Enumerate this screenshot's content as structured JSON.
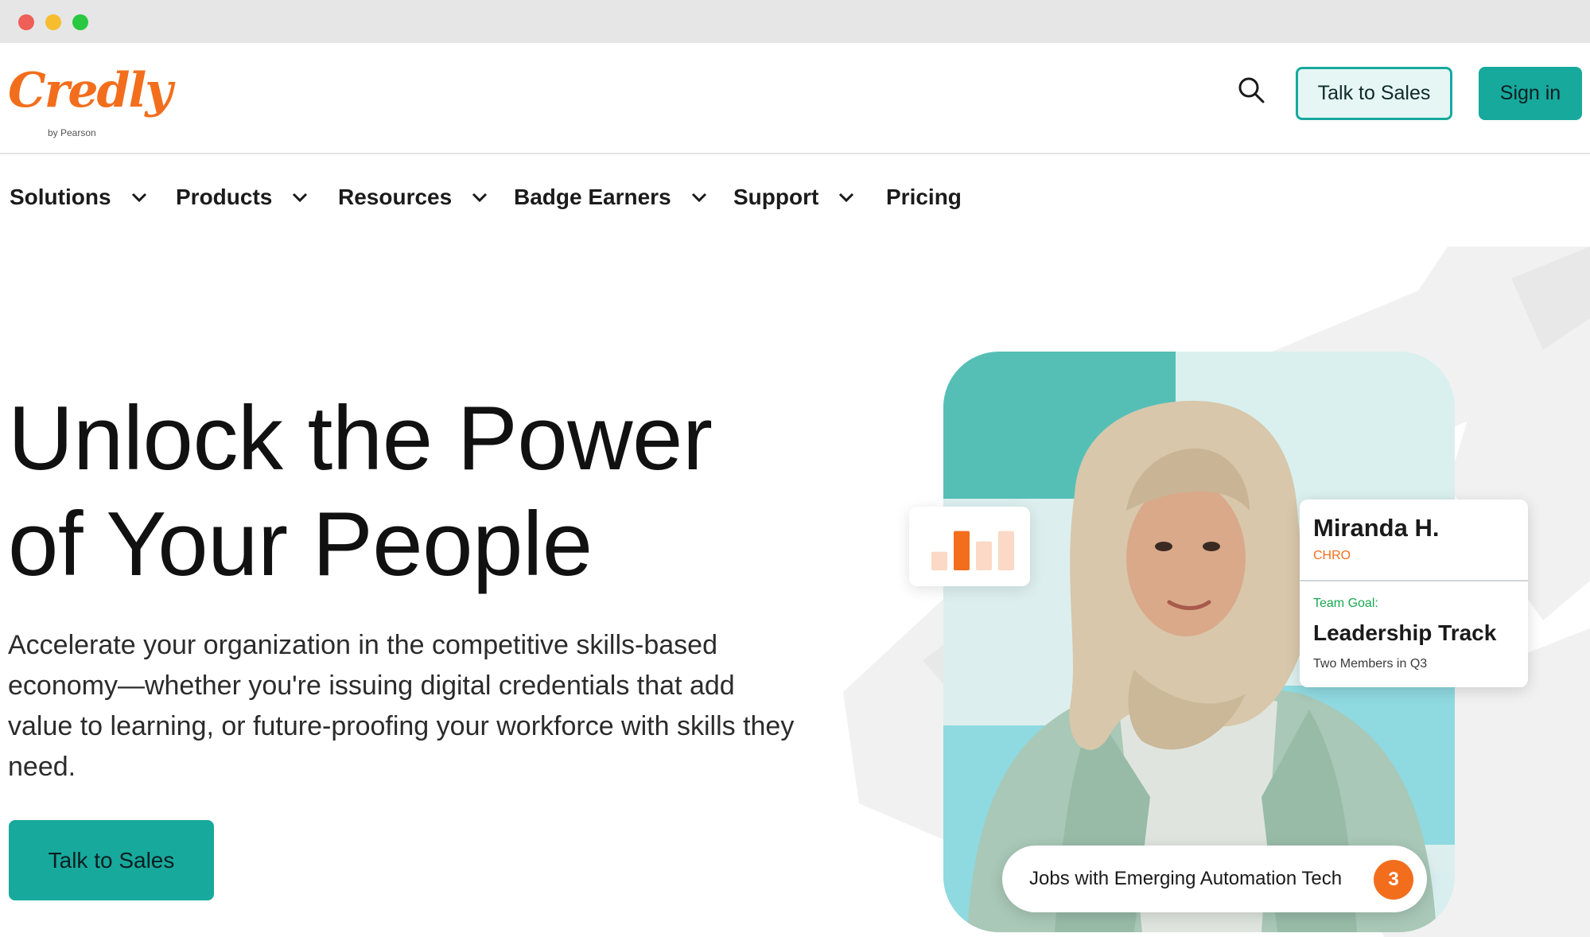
{
  "window": {
    "traffic_lights": [
      "close",
      "minimize",
      "zoom"
    ]
  },
  "header": {
    "logo_text": "Credly",
    "logo_subtext": "by Pearson",
    "search_icon": "search-icon",
    "talk_to_sales_label": "Talk to Sales",
    "sign_in_label": "Sign in"
  },
  "nav": {
    "items": [
      {
        "label": "Solutions",
        "has_dropdown": true
      },
      {
        "label": "Products",
        "has_dropdown": true
      },
      {
        "label": "Resources",
        "has_dropdown": true
      },
      {
        "label": "Badge Earners",
        "has_dropdown": true
      },
      {
        "label": "Support",
        "has_dropdown": true
      },
      {
        "label": "Pricing",
        "has_dropdown": false
      }
    ]
  },
  "hero": {
    "title_line1": "Unlock the Power",
    "title_line2": "of Your People",
    "body": "Accelerate your organization in the competitive skills-based economy—whether you're issuing digital credentials that add value to learning, or future-proofing your workforce with skills they need.",
    "cta_label": "Talk to Sales"
  },
  "profile_card": {
    "name": "Miranda H.",
    "role": "CHRO",
    "goal_label": "Team Goal:",
    "goal": "Leadership Track",
    "goal_sub": "Two Members in Q3"
  },
  "pill": {
    "text": "Jobs with Emerging Automation Tech",
    "count": "3"
  },
  "colors": {
    "brand_orange": "#f26e1d",
    "teal": "#18a99d",
    "teal_light": "#55bfb6",
    "green_label": "#18a94f"
  },
  "chart_data": {
    "type": "bar",
    "categories": [
      "",
      "",
      "",
      ""
    ],
    "values": [
      0.45,
      0.95,
      0.7,
      0.95
    ],
    "highlight_index": 1,
    "title": "",
    "xlabel": "",
    "ylabel": ""
  }
}
